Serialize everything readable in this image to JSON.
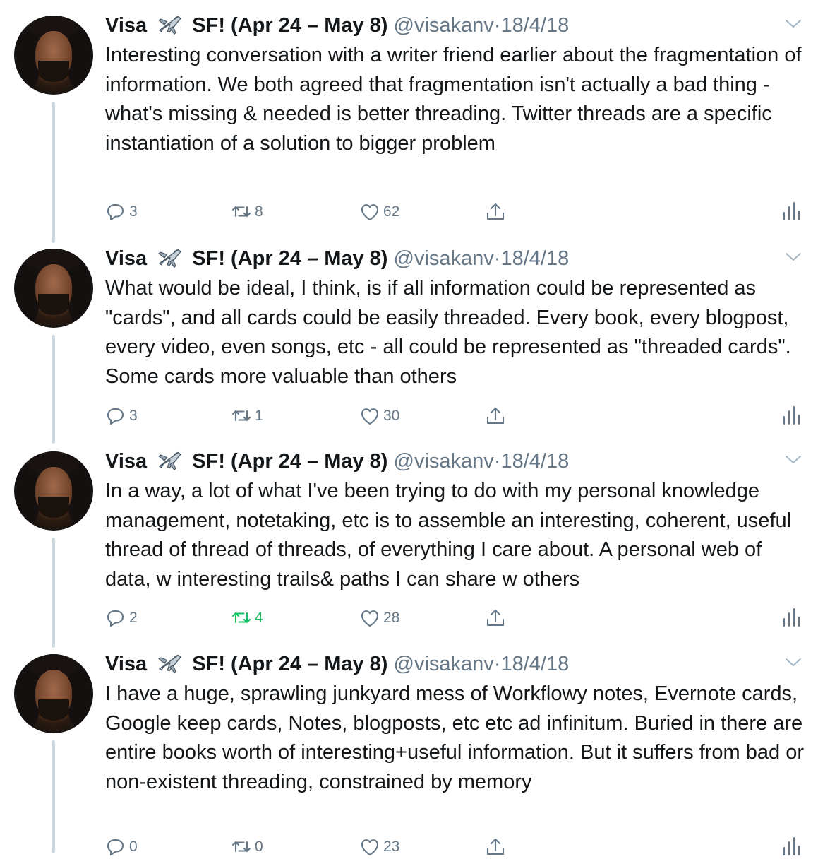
{
  "author": {
    "name": "Visa",
    "emoji_name": "airplane-icon",
    "name_suffix": "SF!  (Apr 24 – May 8)",
    "handle": "@visakanv",
    "separator": "·",
    "date": "18/4/18"
  },
  "tweets": [
    {
      "text": "Interesting conversation with a writer friend earlier about the fragmentation of information. We both agreed that fragmentation isn't actually a bad thing - what's missing & needed is better threading. Twitter threads are a specific instantiation of a solution to bigger problem",
      "replies": "3",
      "retweets": "8",
      "likes": "62",
      "retweeted": false
    },
    {
      "text": "What would be ideal, I think, is if all information could be represented as \"cards\", and all cards could be easily threaded. Every book, every blogpost, every video, even songs, etc - all could be represented as \"threaded cards\". Some cards more valuable than others",
      "replies": "3",
      "retweets": "1",
      "likes": "30",
      "retweeted": false
    },
    {
      "text": "In a way, a lot of what I've been trying to do with my personal knowledge management, notetaking, etc is to assemble an interesting, coherent, useful thread of thread of threads, of everything I care about. A personal web of data, w interesting trails& paths I can share w others",
      "replies": "2",
      "retweets": "4",
      "likes": "28",
      "retweeted": true
    },
    {
      "text": "I have a huge, sprawling junkyard mess of Workflowy notes, Evernote cards, Google keep cards, Notes, blogposts, etc etc ad infinitum. Buried in there are entire books worth of interesting+useful information. But it suffers from bad or non-existent threading, constrained by memory",
      "replies": "0",
      "retweets": "0",
      "likes": "23",
      "retweeted": false
    }
  ],
  "colors": {
    "text": "#14171a",
    "secondary": "#657786",
    "thread_line": "#ccd6dd",
    "retweet_active": "#17bf63"
  }
}
